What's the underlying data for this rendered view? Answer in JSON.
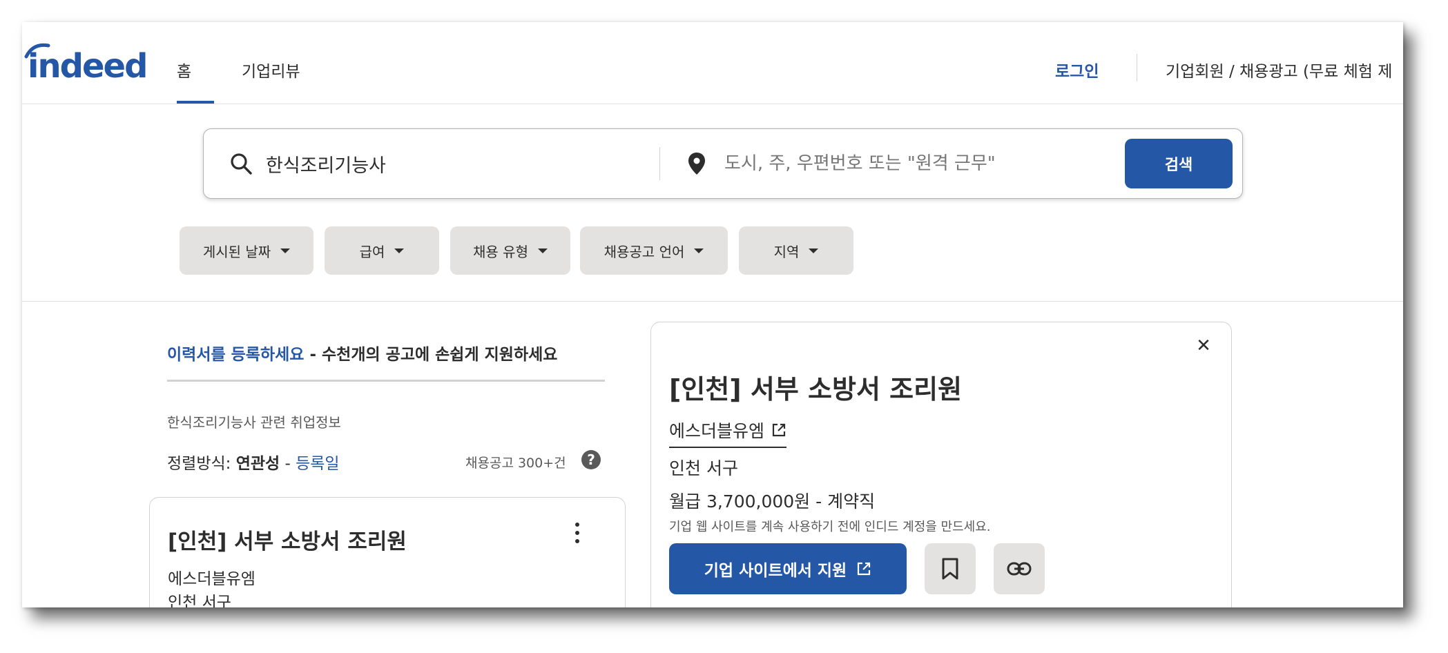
{
  "header": {
    "logo_text": "indeed",
    "tabs": [
      {
        "label": "홈"
      },
      {
        "label": "기업리뷰"
      }
    ],
    "login_label": "로그인",
    "employer_label": "기업회원 / 채용광고 (무료 체험 제"
  },
  "search": {
    "what_value": "한식조리기능사",
    "where_placeholder": "도시, 주, 우편번호 또는 \"원격 근무\"",
    "button_label": "검색"
  },
  "filters": [
    {
      "label": "게시된 날짜"
    },
    {
      "label": "급여"
    },
    {
      "label": "채용 유형"
    },
    {
      "label": "채용공고 언어"
    },
    {
      "label": "지역"
    }
  ],
  "results": {
    "resume_link": "이력서를 등록하세요",
    "resume_rest": " - 수천개의 공고에 손쉽게 지원하세요",
    "related_info": "한식조리기능사 관련 취업정보",
    "sort_prefix": "정렬방식: ",
    "sort_relevance": "연관성",
    "sort_sep": " - ",
    "sort_date": "등록일",
    "job_count": "채용공고 300+건",
    "help_glyph": "?"
  },
  "job_card": {
    "title": "[인천] 서부 소방서 조리원",
    "company": "에스더블유엠",
    "location": "인천 서구"
  },
  "detail": {
    "title": "[인천] 서부 소방서 조리원",
    "company": "에스더블유엠",
    "location": "인천 서구",
    "salary": "월급 3,700,000원  - 계약직",
    "note": "기업 웹 사이트를 계속 사용하기 전에 인디드 계정을 만드세요.",
    "apply_label": "기업 사이트에서 지원",
    "close_glyph": "✕"
  },
  "colors": {
    "brand": "#2557a7",
    "text": "#2d2d2d",
    "chip_bg": "#e4e2e0"
  }
}
